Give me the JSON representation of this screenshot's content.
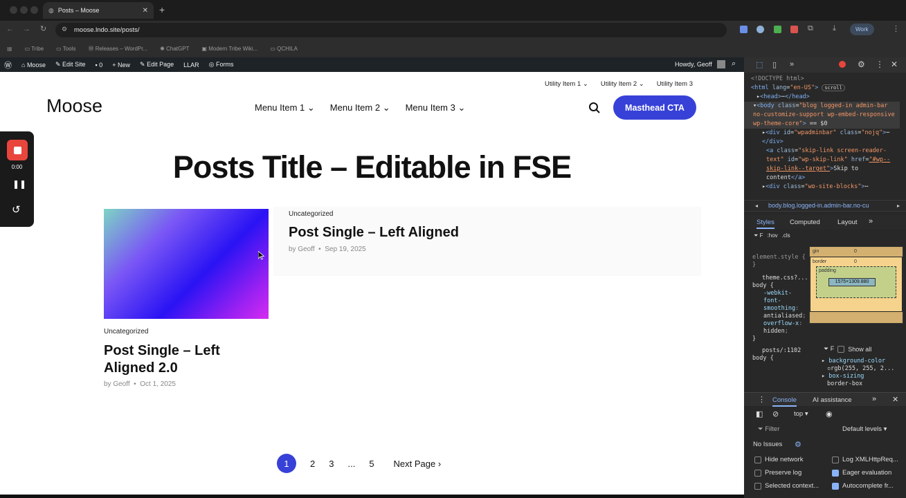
{
  "browser": {
    "tab_title": "Posts – Moose",
    "url": "moose.lndo.site/posts/",
    "bookmarks": [
      "Tribe",
      "Tools",
      "Releases – WordPr...",
      "ChatGPT",
      "Modern Tribe Wiki...",
      "QCHILA"
    ],
    "profile": "Work"
  },
  "wp_admin_bar": {
    "site": "Moose",
    "edit_site": "Edit Site",
    "comments": "0",
    "new": "New",
    "edit_page": "Edit Page",
    "llar": "LLAR",
    "forms": "Forms",
    "howdy": "Howdy, Geoff"
  },
  "site": {
    "utility": [
      "Utility Item 1",
      "Utility Item 2",
      "Utility Item 3"
    ],
    "logo": "Moose",
    "menu": [
      "Menu Item 1",
      "Menu Item 2",
      "Menu Item 3"
    ],
    "cta": "Masthead CTA",
    "page_title": "Posts Title – Editable in FSE",
    "posts": [
      {
        "category": "Uncategorized",
        "title": "Post Single – Left Aligned",
        "by": "by Geoff",
        "date": "Sep 19, 2025"
      },
      {
        "category": "Uncategorized",
        "title": "Post Single – Left Aligned 2.0",
        "by": "by Geoff",
        "date": "Oct 1, 2025"
      }
    ],
    "pagination": [
      "1",
      "2",
      "3",
      "...",
      "5"
    ],
    "next": "Next Page"
  },
  "recorder": {
    "time": "0:00"
  },
  "devtools": {
    "breadcrumb": "body.blog.logged-in.admin-bar.no-cu",
    "tabs": [
      "Styles",
      "Computed",
      "Layout"
    ],
    "filter": "F",
    "hov": ":hov",
    "cls": ".cls",
    "element_style": "element.style {",
    "theme_css": "theme.css?...",
    "posts_ref": "posts/:1102",
    "box_labels": {
      "margin": "gin",
      "border": "border",
      "padding": "padding",
      "size": "1575×1309.880",
      "zero": "0"
    },
    "show_all": "Show all",
    "computed": [
      {
        "prop": "background-color",
        "val": "rgb(255, 255, 2..."
      },
      {
        "prop": "box-sizing",
        "val": "border-box"
      }
    ],
    "drawer_tabs": [
      "Console",
      "AI assistance"
    ],
    "context": "top",
    "console_filter": "Filter",
    "levels": "Default levels",
    "issues": "No Issues",
    "options": [
      {
        "label": "Hide network",
        "checked": false
      },
      {
        "label": "Log XMLHttpReq...",
        "checked": false
      },
      {
        "label": "Preserve log",
        "checked": false
      },
      {
        "label": "Eager evaluation",
        "checked": true
      },
      {
        "label": "Selected context...",
        "checked": false
      },
      {
        "label": "Autocomplete fr...",
        "checked": true
      }
    ]
  }
}
